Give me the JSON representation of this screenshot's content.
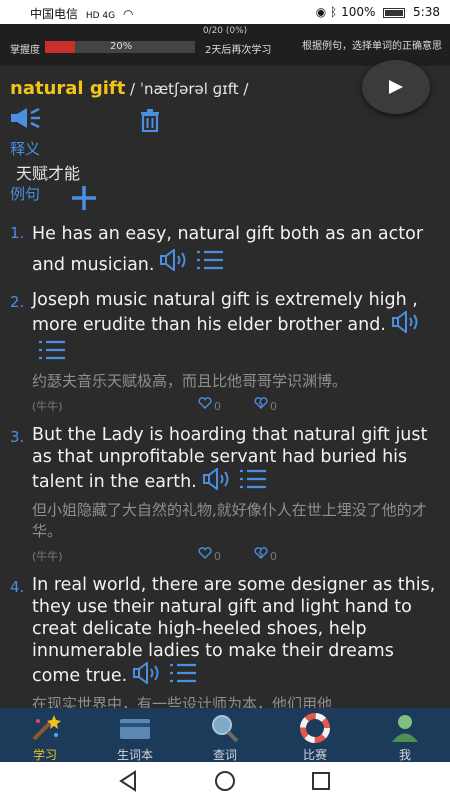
{
  "status_bar": {
    "carrier": "中国电信",
    "network": "HD 4G",
    "battery": "100%",
    "time": "5:38"
  },
  "top_bar": {
    "progress_text": "0/20 (0%)",
    "mastery_label": "掌握度",
    "mastery_percent_text": "20%",
    "mastery_fraction": 0.2,
    "next_review": "2天后再次学习",
    "hint": "根据例句，选择单词的正确意思"
  },
  "word": {
    "text": "natural gift",
    "phonetic": "/ ˈnætʃərəl ɡɪft /"
  },
  "sections": {
    "meaning_label": "释义",
    "meaning": "天赋才能",
    "examples_label": "例句"
  },
  "examples": [
    {
      "num": "1.",
      "en": "He has an easy, natural gift both as an actor and musician."
    },
    {
      "num": "2.",
      "en": "Joseph music natural gift is extremely high , more erudite than his elder brother and.",
      "zh": "约瑟夫音乐天赋极高，而且比他哥哥学识渊博。",
      "source": "(牛牛)",
      "likes": "0",
      "dislikes": "0"
    },
    {
      "num": "3.",
      "en": "But the Lady is hoarding that natural gift just as that unprofitable servant had buried his talent in the earth.",
      "zh": "但小姐隐藏了大自然的礼物,就好像仆人在世上埋没了他的才华。",
      "source": "(牛牛)",
      "likes": "0",
      "dislikes": "0"
    },
    {
      "num": "4.",
      "en": "In real world, there are some designer as this, they use their natural gift and light hand to creat delicate high-heeled shoes, help innumerable ladies to make their dreams come true.",
      "zh": "在现实世界中，有一些设计师为本，他们用他"
    }
  ],
  "tabs": [
    {
      "label": "学习",
      "icon": "wand-icon",
      "active": true
    },
    {
      "label": "生词本",
      "icon": "card-icon",
      "active": false
    },
    {
      "label": "查词",
      "icon": "magnifier-icon",
      "active": false
    },
    {
      "label": "比赛",
      "icon": "lifebuoy-icon",
      "active": false
    },
    {
      "label": "我",
      "icon": "person-icon",
      "active": false
    }
  ],
  "colors": {
    "accent_blue": "#4a8fe0",
    "word_yellow": "#f0c419",
    "background": "#2b2b2b",
    "tabbar": "#1c3b5a"
  }
}
